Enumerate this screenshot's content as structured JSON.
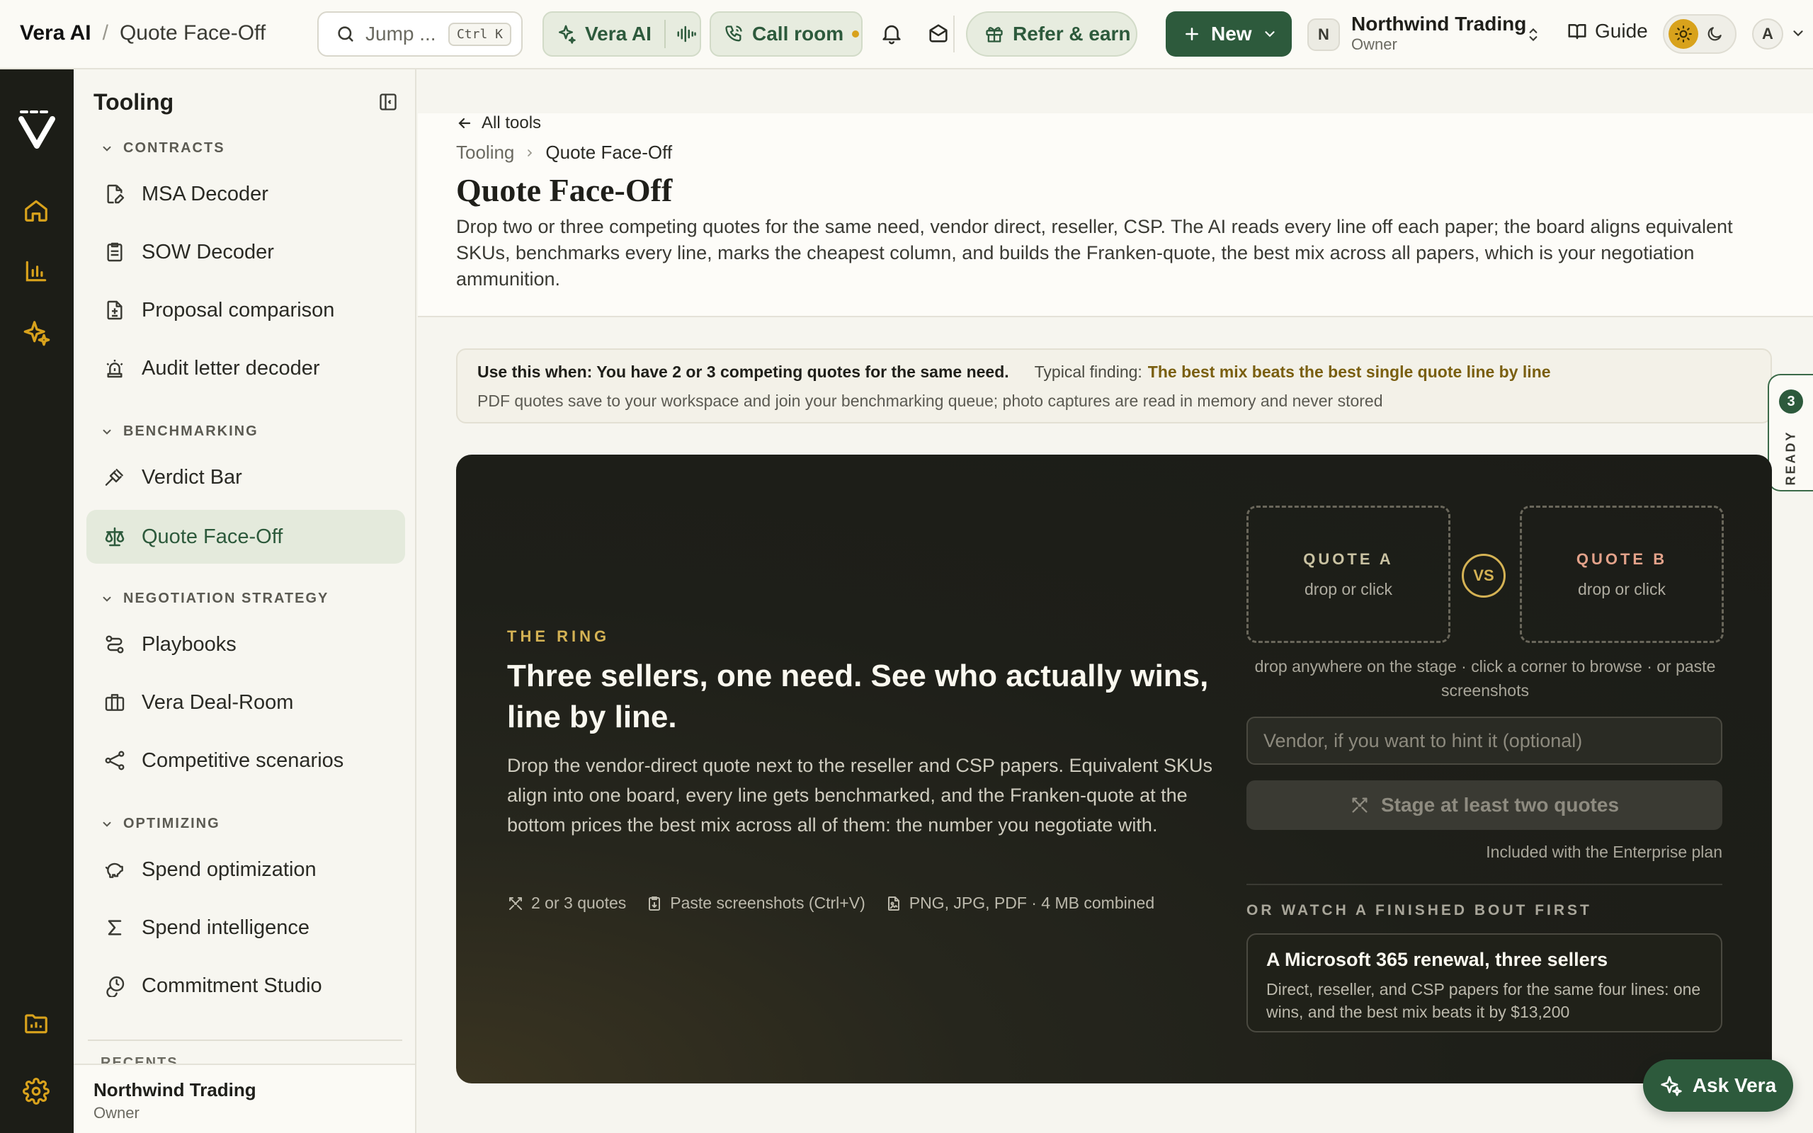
{
  "topbar": {
    "app_name": "Vera AI",
    "breadcrumb_sep": "/",
    "breadcrumb_current": "Quote Face-Off",
    "search_placeholder": "Jump ...",
    "search_shortcut": "Ctrl K",
    "vera_ai_label": "Vera AI",
    "call_room_label": "Call room",
    "refer_label": "Refer & earn",
    "new_label": "New",
    "org_initial": "N",
    "org_name": "Northwind Trading",
    "org_role": "Owner",
    "guide_label": "Guide",
    "user_initial": "A"
  },
  "sidebar": {
    "title": "Tooling",
    "sections": [
      {
        "label": "CONTRACTS",
        "items": [
          "MSA Decoder",
          "SOW Decoder",
          "Proposal comparison",
          "Audit letter decoder"
        ]
      },
      {
        "label": "BENCHMARKING",
        "items": [
          "Verdict Bar",
          "Quote Face-Off"
        ]
      },
      {
        "label": "NEGOTIATION STRATEGY",
        "items": [
          "Playbooks",
          "Vera Deal-Room",
          "Competitive scenarios"
        ]
      },
      {
        "label": "OPTIMIZING",
        "items": [
          "Spend optimization",
          "Spend intelligence",
          "Commitment Studio"
        ]
      }
    ],
    "recents_label": "RECENTS",
    "footer_name": "Northwind Trading",
    "footer_role": "Owner"
  },
  "page": {
    "back_label": "All tools",
    "breadcrumb_parent": "Tooling",
    "breadcrumb_current": "Quote Face-Off",
    "title": "Quote Face-Off",
    "description": "Drop two or three competing quotes for the same need, vendor direct, reseller, CSP. The AI reads every line off each paper; the board aligns equivalent SKUs, benchmarks every line, marks the cheapest column, and builds the Franken-quote, the best mix across all papers, which is your negotiation ammunition."
  },
  "callout": {
    "use_when": "Use this when: You have 2 or 3 competing quotes for the same need.",
    "typical_label": "Typical finding:",
    "typical_value": "The best mix beats the best single quote line by line",
    "storage_note": "PDF quotes save to your workspace and join your benchmarking queue; photo captures are read in memory and never stored"
  },
  "ready_tab": {
    "count": "3",
    "label": "READY"
  },
  "stage": {
    "eyebrow": "THE RING",
    "title": "Three sellers, one need. See who actually wins, line by line.",
    "description": "Drop the vendor-direct quote next to the reseller and CSP papers. Equivalent SKUs align into one board, every line gets benchmarked, and the Franken-quote at the bottom prices the best mix across all of them: the number you negotiate with.",
    "chips": [
      "2 or 3 quotes",
      "Paste screenshots (Ctrl+V)",
      "PNG, JPG, PDF · 4 MB combined"
    ],
    "quote_a_label": "QUOTE A",
    "quote_b_label": "QUOTE B",
    "drop_sub": "drop or click",
    "vs_label": "VS",
    "drop_hint": "drop anywhere on the stage · click a corner to browse · or paste screenshots",
    "vendor_placeholder": "Vendor, if you want to hint it (optional)",
    "stage_button": "Stage at least two quotes",
    "included_note": "Included with the Enterprise plan",
    "watch_label": "OR WATCH A FINISHED BOUT FIRST",
    "demo_title": "A Microsoft 365 renewal, three sellers",
    "demo_desc": "Direct, reseller, and CSP papers for the same four lines: one wins, and the best mix beats it by $13,200"
  },
  "ask_vera_label": "Ask Vera",
  "colors": {
    "brand_green": "#2d5a3c",
    "accent_gold": "#d4b254",
    "rail_bg": "#1c1d17",
    "stage_bg": "#1e1f19"
  }
}
